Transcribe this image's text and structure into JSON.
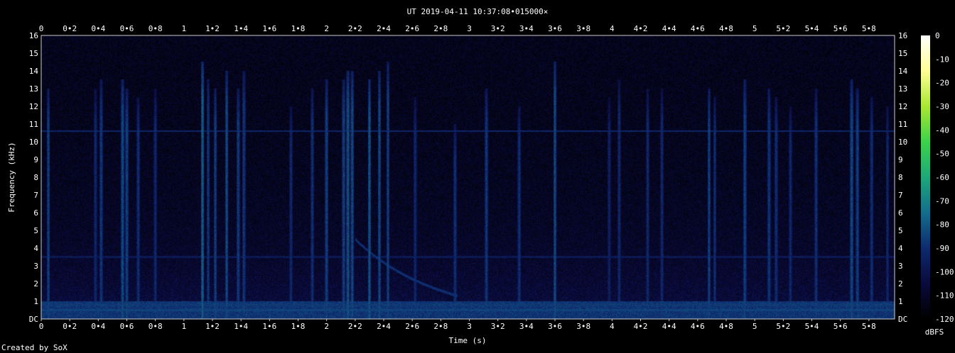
{
  "chart_data": {
    "type": "heatmap",
    "title": "UT 2019-04-11 10:37:08•015000×",
    "xlabel": "Time (s)",
    "ylabel": "Frequency (kHz)",
    "footer": "Created by SoX",
    "colorbar_label": "dBFS",
    "x_ticks": [
      "0",
      "0•2",
      "0•4",
      "0•6",
      "0•8",
      "1",
      "1•2",
      "1•4",
      "1•6",
      "1•8",
      "2",
      "2•2",
      "2•4",
      "2•6",
      "2•8",
      "3",
      "3•2",
      "3•4",
      "3•6",
      "3•8",
      "4",
      "4•2",
      "4•4",
      "4•6",
      "4•8",
      "5",
      "5•2",
      "5•4",
      "5•6",
      "5•8"
    ],
    "y_ticks": [
      "DC",
      "1",
      "2",
      "3",
      "4",
      "5",
      "6",
      "7",
      "8",
      "9",
      "10",
      "11",
      "12",
      "13",
      "14",
      "15",
      "16"
    ],
    "colorbar_ticks": [
      "0",
      "-10",
      "-20",
      "-30",
      "-40",
      "-50",
      "-60",
      "-70",
      "-80",
      "-90",
      "-100",
      "-110",
      "-120"
    ],
    "xlim": [
      0,
      5.98
    ],
    "ylim": [
      0,
      16
    ],
    "zlim": [
      -120,
      0
    ],
    "colormap": [
      "#000000",
      "#0a0a3c",
      "#0e2a6e",
      "#146e8c",
      "#1ea87a",
      "#3cd24a",
      "#aae632",
      "#ffff96",
      "#ffffff"
    ],
    "background_level_dbfs": -105,
    "low_band": {
      "freq_range_khz": [
        0,
        1.0
      ],
      "level_dbfs": -88
    },
    "horizontal_lines": [
      {
        "freq_khz": 10.6,
        "level_dbfs": -92
      },
      {
        "freq_khz": 3.5,
        "level_dbfs": -98
      },
      {
        "freq_khz": 0.8,
        "level_dbfs": -88
      },
      {
        "freq_khz": 0.5,
        "level_dbfs": -85
      }
    ],
    "vertical_events": [
      {
        "time_s": 0.05,
        "fmax_khz": 13.0,
        "level_dbfs": -84
      },
      {
        "time_s": 0.38,
        "fmax_khz": 13.0,
        "level_dbfs": -90
      },
      {
        "time_s": 0.42,
        "fmax_khz": 13.5,
        "level_dbfs": -86
      },
      {
        "time_s": 0.57,
        "fmax_khz": 13.5,
        "level_dbfs": -82
      },
      {
        "time_s": 0.6,
        "fmax_khz": 13.0,
        "level_dbfs": -84
      },
      {
        "time_s": 0.68,
        "fmax_khz": 12.5,
        "level_dbfs": -88
      },
      {
        "time_s": 0.8,
        "fmax_khz": 13.0,
        "level_dbfs": -90
      },
      {
        "time_s": 1.13,
        "fmax_khz": 14.5,
        "level_dbfs": -78
      },
      {
        "time_s": 1.17,
        "fmax_khz": 13.5,
        "level_dbfs": -86
      },
      {
        "time_s": 1.22,
        "fmax_khz": 13.0,
        "level_dbfs": -84
      },
      {
        "time_s": 1.3,
        "fmax_khz": 14.0,
        "level_dbfs": -82
      },
      {
        "time_s": 1.38,
        "fmax_khz": 13.0,
        "level_dbfs": -85
      },
      {
        "time_s": 1.42,
        "fmax_khz": 14.0,
        "level_dbfs": -86
      },
      {
        "time_s": 1.75,
        "fmax_khz": 12.0,
        "level_dbfs": -90
      },
      {
        "time_s": 1.9,
        "fmax_khz": 13.0,
        "level_dbfs": -88
      },
      {
        "time_s": 2.0,
        "fmax_khz": 13.5,
        "level_dbfs": -84
      },
      {
        "time_s": 2.12,
        "fmax_khz": 13.5,
        "level_dbfs": -84
      },
      {
        "time_s": 2.15,
        "fmax_khz": 14.0,
        "level_dbfs": -80
      },
      {
        "time_s": 2.18,
        "fmax_khz": 14.0,
        "level_dbfs": -82
      },
      {
        "time_s": 2.3,
        "fmax_khz": 13.5,
        "level_dbfs": -80
      },
      {
        "time_s": 2.37,
        "fmax_khz": 14.0,
        "level_dbfs": -82
      },
      {
        "time_s": 2.43,
        "fmax_khz": 14.5,
        "level_dbfs": -84
      },
      {
        "time_s": 2.62,
        "fmax_khz": 12.5,
        "level_dbfs": -90
      },
      {
        "time_s": 2.9,
        "fmax_khz": 11.0,
        "level_dbfs": -88
      },
      {
        "time_s": 3.12,
        "fmax_khz": 13.0,
        "level_dbfs": -86
      },
      {
        "time_s": 3.35,
        "fmax_khz": 12.0,
        "level_dbfs": -88
      },
      {
        "time_s": 3.6,
        "fmax_khz": 14.5,
        "level_dbfs": -82
      },
      {
        "time_s": 3.98,
        "fmax_khz": 12.5,
        "level_dbfs": -92
      },
      {
        "time_s": 4.05,
        "fmax_khz": 13.5,
        "level_dbfs": -90
      },
      {
        "time_s": 4.25,
        "fmax_khz": 13.0,
        "level_dbfs": -90
      },
      {
        "time_s": 4.35,
        "fmax_khz": 13.0,
        "level_dbfs": -90
      },
      {
        "time_s": 4.68,
        "fmax_khz": 13.0,
        "level_dbfs": -84
      },
      {
        "time_s": 4.72,
        "fmax_khz": 12.5,
        "level_dbfs": -88
      },
      {
        "time_s": 4.93,
        "fmax_khz": 13.5,
        "level_dbfs": -84
      },
      {
        "time_s": 5.1,
        "fmax_khz": 13.0,
        "level_dbfs": -86
      },
      {
        "time_s": 5.15,
        "fmax_khz": 12.5,
        "level_dbfs": -88
      },
      {
        "time_s": 5.25,
        "fmax_khz": 12.0,
        "level_dbfs": -90
      },
      {
        "time_s": 5.43,
        "fmax_khz": 13.0,
        "level_dbfs": -88
      },
      {
        "time_s": 5.68,
        "fmax_khz": 13.5,
        "level_dbfs": -82
      },
      {
        "time_s": 5.72,
        "fmax_khz": 13.0,
        "level_dbfs": -84
      },
      {
        "time_s": 5.82,
        "fmax_khz": 12.5,
        "level_dbfs": -88
      },
      {
        "time_s": 5.93,
        "fmax_khz": 12.0,
        "level_dbfs": -90
      }
    ],
    "sweeps": [
      {
        "t_start_s": 2.2,
        "t_end_s": 2.92,
        "f_start_khz": 4.5,
        "f_end_khz": 1.3,
        "level_dbfs": -90
      }
    ]
  }
}
